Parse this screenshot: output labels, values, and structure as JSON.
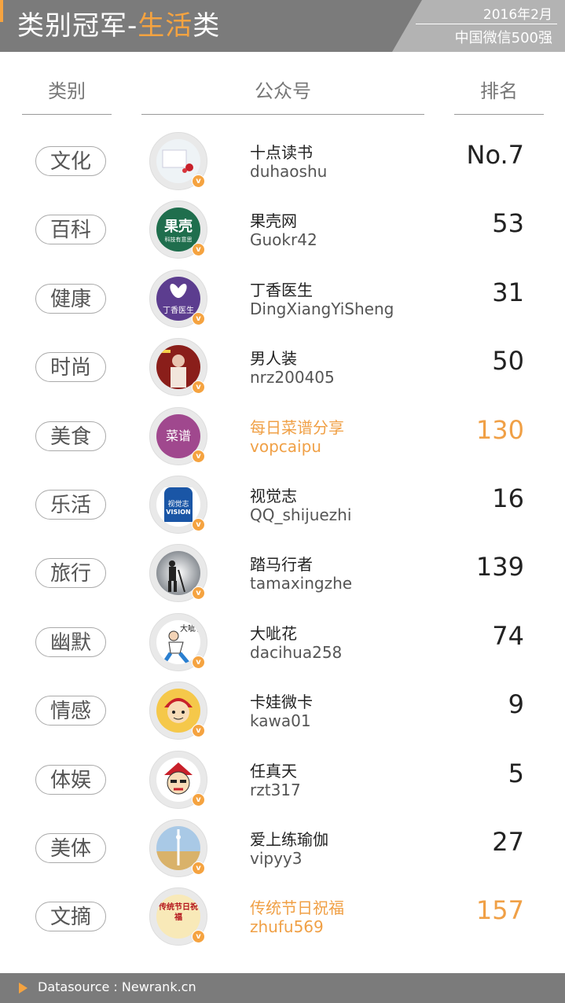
{
  "header": {
    "title_prefix": "类别冠军-",
    "title_highlight": "生活",
    "title_suffix": "类",
    "date": "2016年2月",
    "subtitle": "中国微信500强",
    "accent_color": "#f5a340"
  },
  "columns": {
    "category": "类别",
    "account": "公众号",
    "rank": "排名"
  },
  "rows": [
    {
      "category": "文化",
      "name": "十点读书",
      "account": "duhaoshu",
      "rank": "No.7",
      "highlight": false,
      "avatar_icon": "flower-cup-icon"
    },
    {
      "category": "百科",
      "name": "果壳网",
      "account": "Guokr42",
      "rank": "53",
      "highlight": false,
      "avatar_icon": "guokr-logo-icon",
      "avatar_text": "果壳",
      "avatar_sub": "科技有意思"
    },
    {
      "category": "健康",
      "name": "丁香医生",
      "account": "DingXiangYiSheng",
      "rank": "31",
      "highlight": false,
      "avatar_icon": "dingxiang-logo-icon",
      "avatar_text": "丁香医生"
    },
    {
      "category": "时尚",
      "name": "男人装",
      "account": "nrz200405",
      "rank": "50",
      "highlight": false,
      "avatar_icon": "magazine-cover-icon"
    },
    {
      "category": "美食",
      "name": "每日菜谱分享",
      "account": "vopcaipu",
      "rank": "130",
      "highlight": true,
      "avatar_icon": "caipu-logo-icon",
      "avatar_text": "菜谱"
    },
    {
      "category": "乐活",
      "name": "视觉志",
      "account": "QQ_shijuezhi",
      "rank": "16",
      "highlight": false,
      "avatar_icon": "vision-logo-icon",
      "avatar_text": "视觉志",
      "avatar_sub": "VISION"
    },
    {
      "category": "旅行",
      "name": "踏马行者",
      "account": "tamaxingzhe",
      "rank": "139",
      "highlight": false,
      "avatar_icon": "hiker-silhouette-icon"
    },
    {
      "category": "幽默",
      "name": "大呲花",
      "account": "dacihua258",
      "rank": "74",
      "highlight": false,
      "avatar_icon": "cartoon-figure-icon",
      "avatar_text": "大呲花"
    },
    {
      "category": "情感",
      "name": "卡娃微卡",
      "account": "kawa01",
      "rank": "9",
      "highlight": false,
      "avatar_icon": "cartoon-boy-icon"
    },
    {
      "category": "体娱",
      "name": "任真天",
      "account": "rzt317",
      "rank": "5",
      "highlight": false,
      "avatar_icon": "cartoon-face-icon"
    },
    {
      "category": "美体",
      "name": "爱上练瑜伽",
      "account": "vipyy3",
      "rank": "27",
      "highlight": false,
      "avatar_icon": "yoga-pose-icon"
    },
    {
      "category": "文摘",
      "name": "传统节日祝福",
      "account": "zhufu569",
      "rank": "157",
      "highlight": true,
      "avatar_icon": "festival-logo-icon",
      "avatar_text": "传统节日祝福"
    }
  ],
  "verified_badge": "v",
  "footer": {
    "source": "Datasource : Newrank.cn"
  }
}
